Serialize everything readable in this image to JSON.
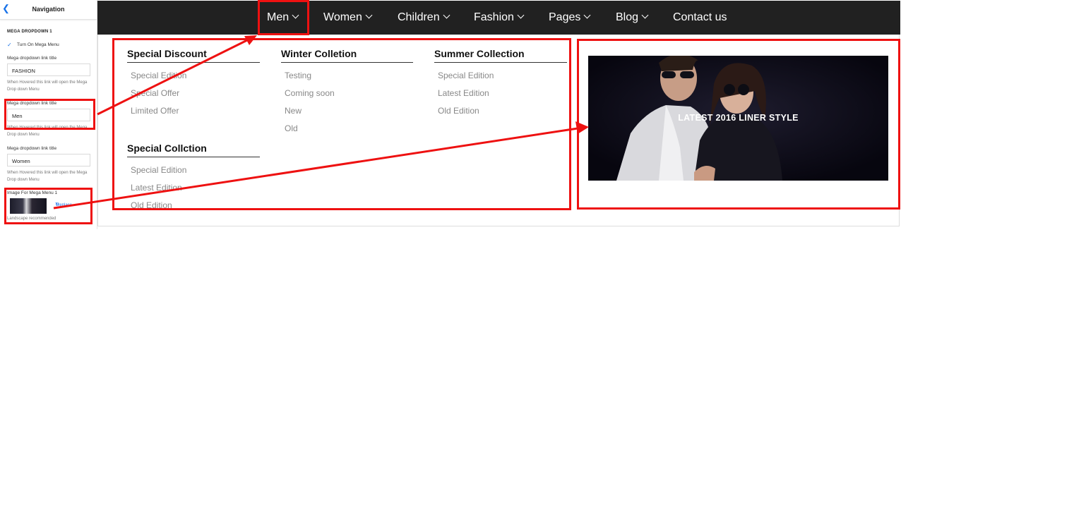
{
  "panel": {
    "title": "Navigation",
    "back_icon": "chevron-left-icon",
    "section_title": "MEGA DROPDOWN 1",
    "toggle_label": "Turn On Mega Menu",
    "toggle_checked": true,
    "field1_label": "Mega dropdown link title",
    "field1_value": "FASHION",
    "field1_help": "When Hovered this link will open the Mega Drop down Menu",
    "field2_label": "Mega dropdown link title",
    "field2_value": "Men",
    "field2_help": "When Hovered this link will open the Mega Drop down Menu",
    "field3_label": "Mega dropdown link title",
    "field3_value": "Women",
    "field3_help": "When Hovered this link will open the Mega Drop down Menu",
    "image_label": "Image For Mega Menu 1",
    "replace_label": "Replace",
    "image_hint": "Landscape recommended"
  },
  "nav": {
    "items": [
      "Men",
      "Women",
      "Children",
      "Fashion",
      "Pages",
      "Blog",
      "Contact us"
    ]
  },
  "mega": {
    "columns": [
      {
        "title": "Special Discount",
        "links": [
          "Special Edition",
          "Special Offer",
          "Limited Offer"
        ]
      },
      {
        "title": "Winter Colletion",
        "links": [
          "Testing",
          "Coming soon",
          "New",
          "Old"
        ]
      },
      {
        "title": "Summer Collection",
        "links": [
          "Special Edition",
          "Latest Edition",
          "Old Edition"
        ]
      },
      {
        "title": "Special Collction",
        "links": [
          "Special Edition",
          "Latest Edition",
          "Old Edition"
        ]
      }
    ],
    "banner_text": "LATEST 2016 LINER STYLE"
  },
  "colors": {
    "annotation": "#ee1111",
    "navbar": "#212121",
    "accent": "#1a73e8"
  }
}
